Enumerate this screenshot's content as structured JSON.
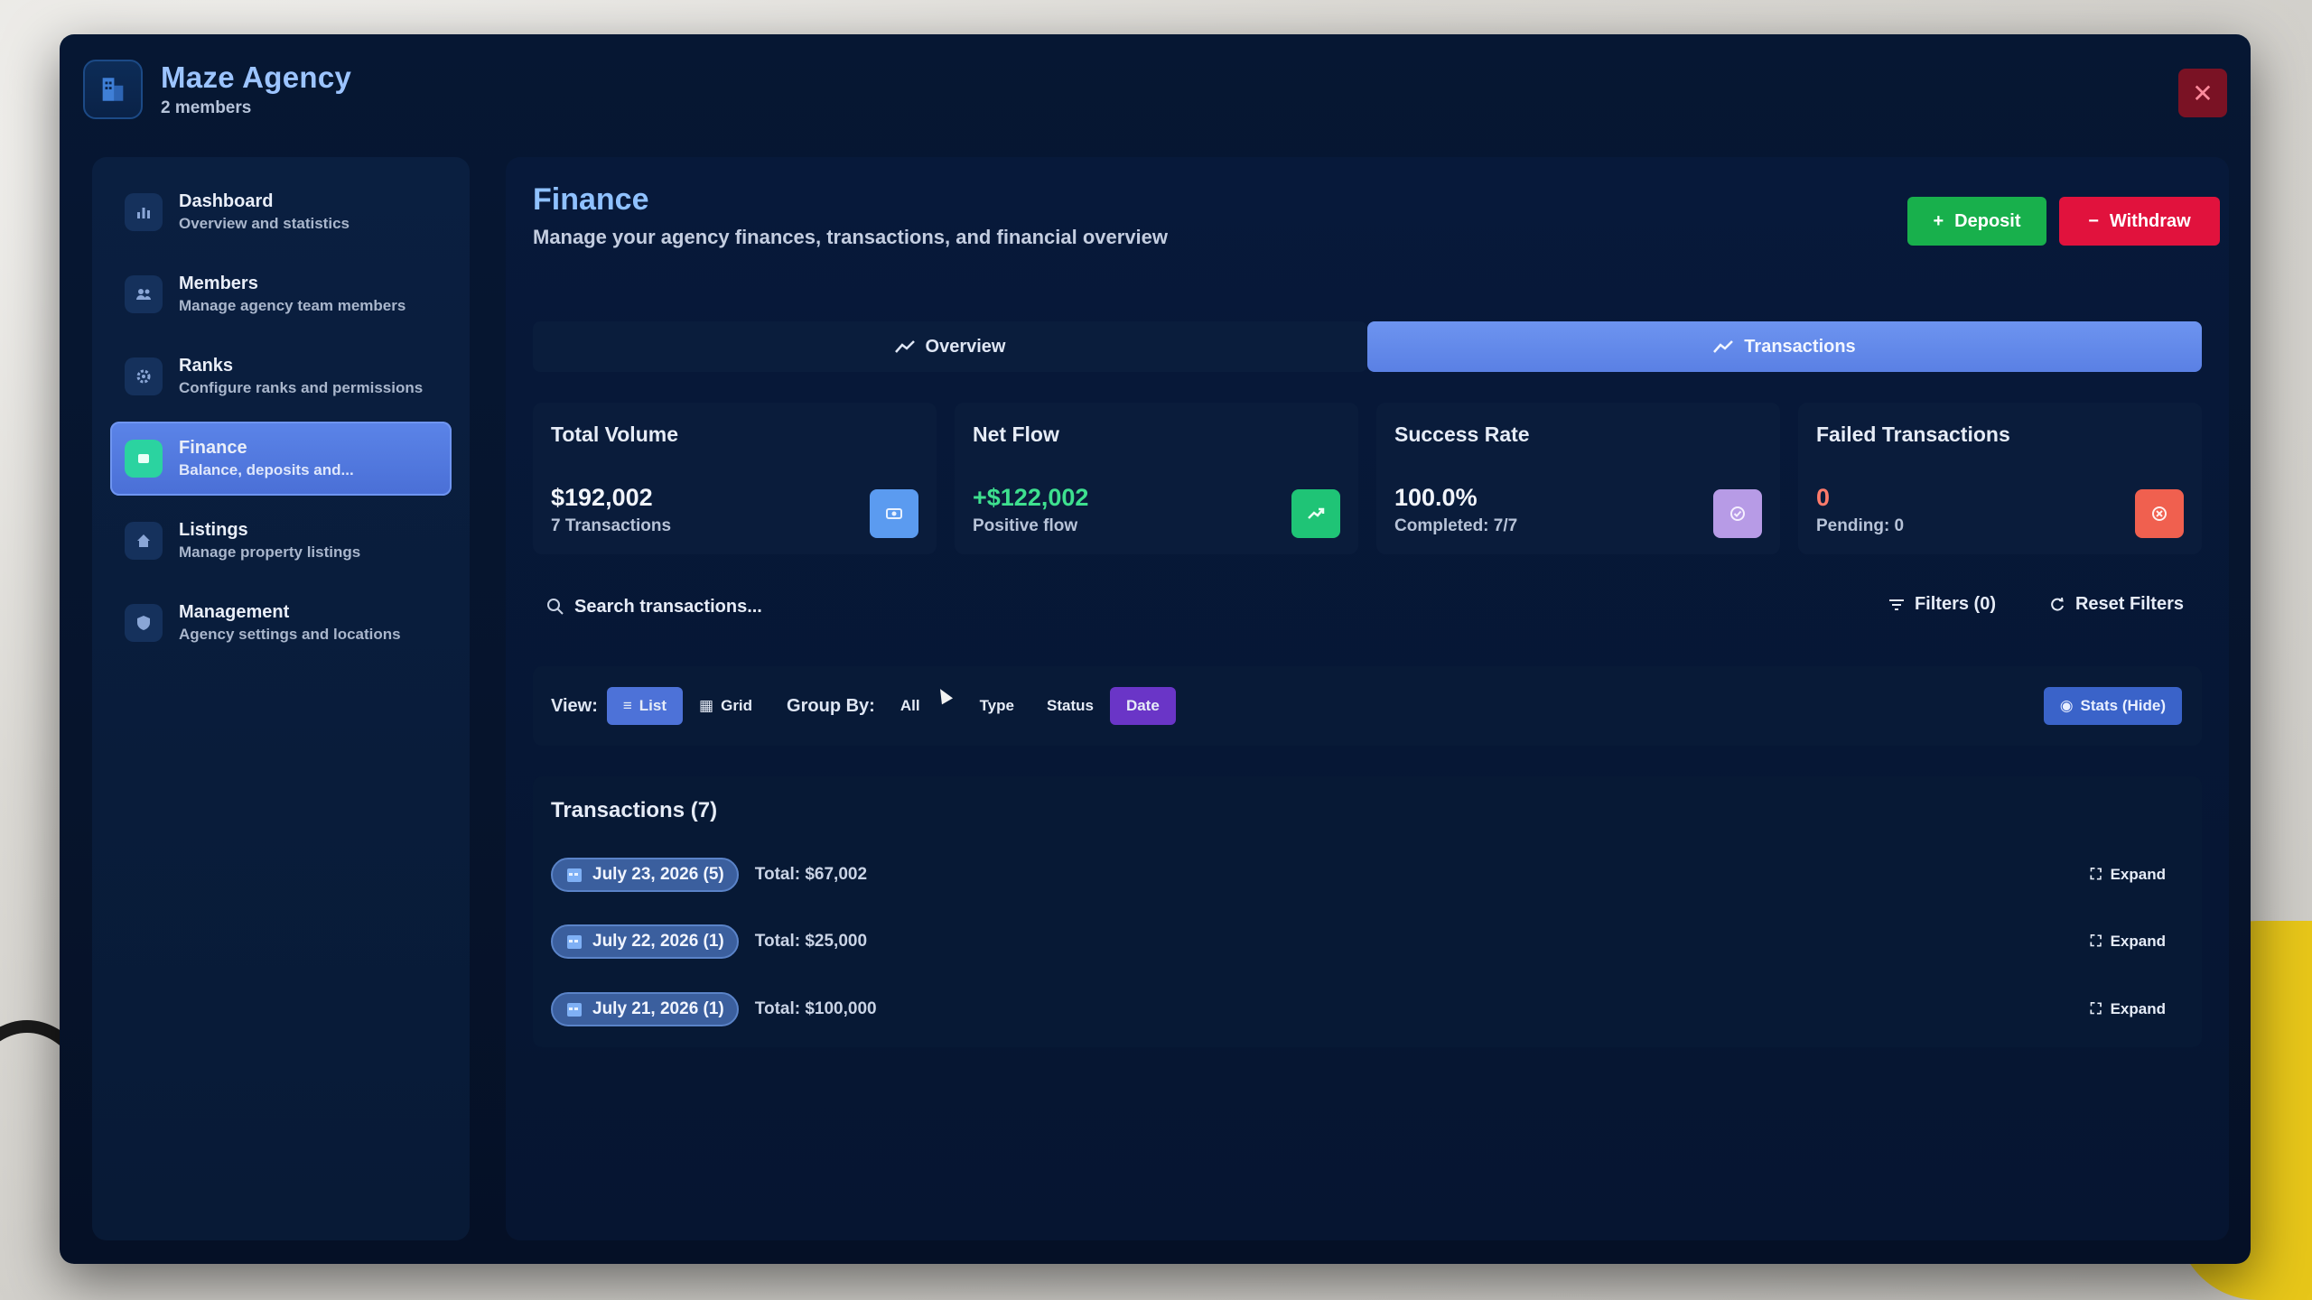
{
  "app": {
    "name": "Maze Agency",
    "members": "2 members",
    "close_icon": "close-icon"
  },
  "sidebar": {
    "items": [
      {
        "title": "Dashboard",
        "subtitle": "Overview and statistics",
        "icon": "bar-chart-icon"
      },
      {
        "title": "Members",
        "subtitle": "Manage agency team members",
        "icon": "users-icon"
      },
      {
        "title": "Ranks",
        "subtitle": "Configure ranks and permissions",
        "icon": "gear-icon"
      },
      {
        "title": "Finance",
        "subtitle": "Balance, deposits and...",
        "icon": "wallet-icon",
        "active": true
      },
      {
        "title": "Listings",
        "subtitle": "Manage property listings",
        "icon": "home-icon"
      },
      {
        "title": "Management",
        "subtitle": "Agency settings and locations",
        "icon": "shield-icon"
      }
    ]
  },
  "page": {
    "title": "Finance",
    "subtitle": "Manage your agency finances, transactions, and financial overview",
    "deposit_label": "Deposit",
    "withdraw_label": "Withdraw"
  },
  "tabs": [
    {
      "label": "Overview",
      "active": false
    },
    {
      "label": "Transactions",
      "active": true
    }
  ],
  "stats": [
    {
      "title": "Total Volume",
      "value": "$192,002",
      "sub": "7 Transactions",
      "icon": "coins-icon",
      "color": "#5b9bf0",
      "value_color": "#f1f4fa"
    },
    {
      "title": "Net Flow",
      "value": "+$122,002",
      "sub": "Positive flow",
      "icon": "trending-up-icon",
      "color": "#1fc476",
      "value_color": "#3ee08f"
    },
    {
      "title": "Success Rate",
      "value": "100.0%",
      "sub": "Completed: 7/7",
      "icon": "check-circle-icon",
      "color": "#b79be6",
      "value_color": "#f1f4fa"
    },
    {
      "title": "Failed Transactions",
      "value": "0",
      "sub": "Pending: 0",
      "icon": "x-circle-icon",
      "color": "#f0604f",
      "value_color": "#ff7b6b"
    }
  ],
  "search": {
    "placeholder": "Search transactions...",
    "filters_label": "Filters (0)",
    "reset_label": "Reset Filters"
  },
  "view_bar": {
    "view_label": "View:",
    "list_label": "List",
    "grid_label": "Grid",
    "group_label": "Group By:",
    "group_options": [
      "All",
      "Type",
      "Status",
      "Date"
    ],
    "group_selected": "Date",
    "stats_toggle_label": "Stats (Hide)"
  },
  "transactions": {
    "title": "Transactions (7)",
    "expand_label": "Expand",
    "groups": [
      {
        "date": "July 23, 2026 (5)",
        "total": "Total: $67,002"
      },
      {
        "date": "July 22, 2026 (1)",
        "total": "Total: $25,000"
      },
      {
        "date": "July 21, 2026 (1)",
        "total": "Total: $100,000"
      }
    ]
  },
  "colors": {
    "accent": "#5a80e4",
    "deposit": "#18b04c",
    "withdraw": "#e1123d",
    "group_selected": "#6a35c7"
  }
}
